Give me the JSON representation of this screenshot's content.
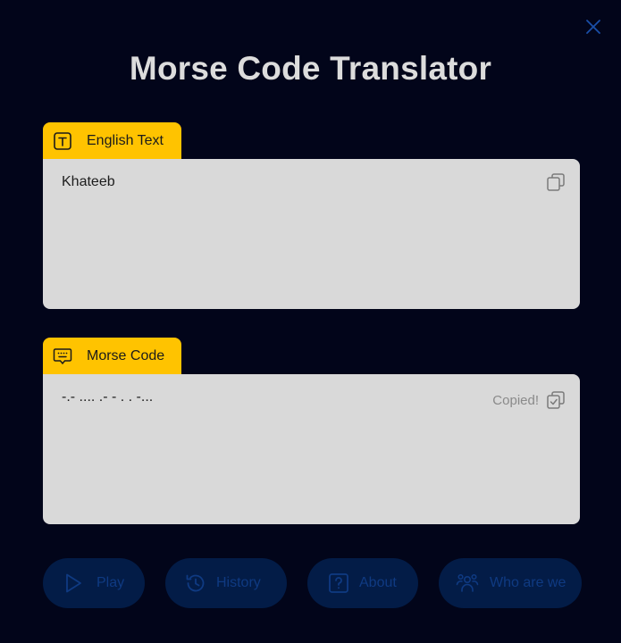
{
  "title": "Morse Code Translator",
  "english": {
    "tab_label": "English Text",
    "value": "Khateeb"
  },
  "morse": {
    "tab_label": "Morse Code",
    "value": "-.- .... .- - . . -...",
    "copied_label": "Copied!"
  },
  "buttons": {
    "play": "Play",
    "history": "History",
    "about": "About",
    "who": "Who are we"
  },
  "colors": {
    "background": "#02051a",
    "accent_tab": "#ffc300",
    "panel": "#d9d9d9",
    "button_bg": "#031c47",
    "button_fg": "#0f3a82",
    "close_icon": "#1a4fa8"
  },
  "icons": {
    "close": "close-icon",
    "english_tab": "text-icon",
    "morse_tab": "keyboard-message-icon",
    "copy": "copy-icon",
    "copied": "copy-check-icon",
    "play": "play-icon",
    "history": "history-icon",
    "about": "question-icon",
    "who": "users-icon"
  }
}
